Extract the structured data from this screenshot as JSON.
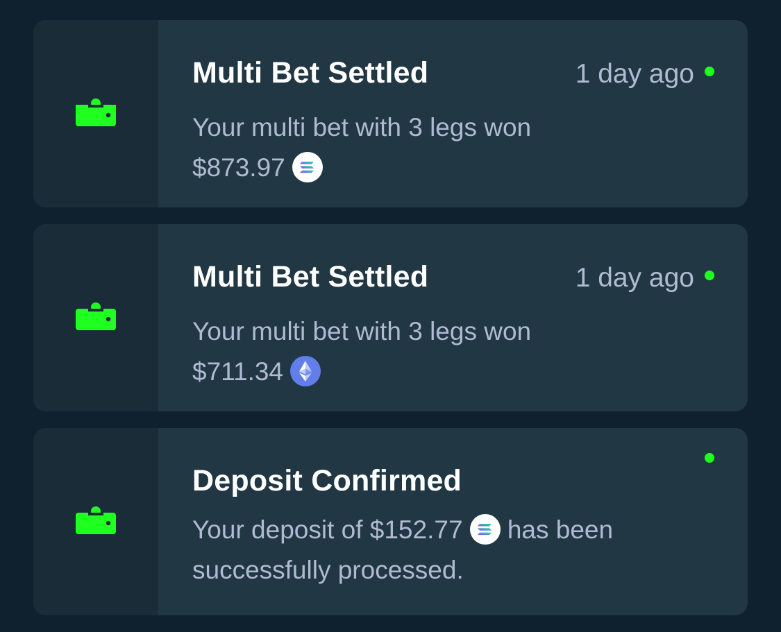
{
  "accent_color": "#1fff20",
  "notifications": [
    {
      "icon": "wallet-icon",
      "title": "Multi Bet Settled",
      "time": "1 day ago",
      "message": "Your multi bet with 3 legs won",
      "amount": "$873.97",
      "currency_icon": "solana-icon",
      "unread": true
    },
    {
      "icon": "wallet-icon",
      "title": "Multi Bet Settled",
      "time": "1 day ago",
      "message": "Your multi bet with 3 legs won",
      "amount": "$711.34",
      "currency_icon": "ethereum-icon",
      "unread": true
    },
    {
      "icon": "wallet-icon",
      "title": "Deposit Confirmed",
      "message_prefix": "Your deposit of",
      "amount": "$152.77",
      "currency_icon": "solana-icon",
      "message_suffix": "has been successfully processed.",
      "unread": true
    }
  ]
}
